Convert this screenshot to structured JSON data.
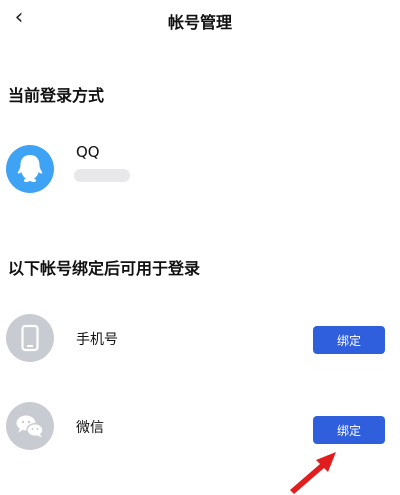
{
  "header": {
    "title": "帐号管理"
  },
  "current_login": {
    "section_title": "当前登录方式",
    "account": {
      "name": "QQ"
    }
  },
  "bind_list": {
    "section_title": "以下帐号绑定后可用于登录",
    "items": [
      {
        "label": "手机号",
        "button_label": "绑定"
      },
      {
        "label": "微信",
        "button_label": "绑定"
      }
    ]
  },
  "colors": {
    "bind_button": "#2f5fdc",
    "qq_avatar": "#3ea2f5",
    "grey_avatar": "#c8ccd2",
    "arrow": "#e11d1d"
  }
}
